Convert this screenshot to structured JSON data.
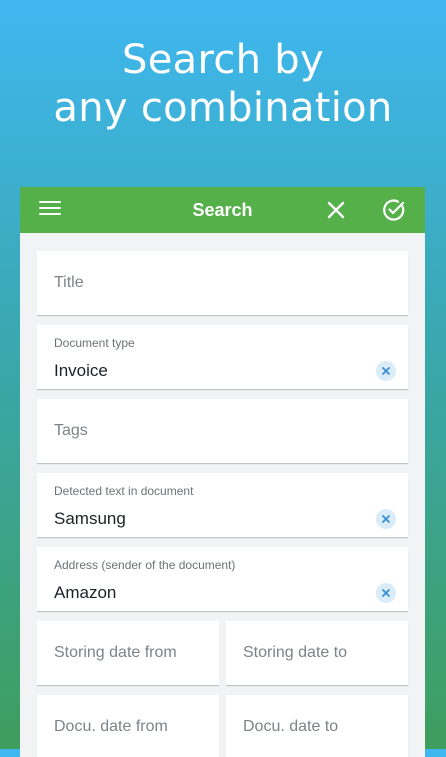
{
  "headline": {
    "line1": "Search by",
    "line2": "any combination"
  },
  "appbar": {
    "title": "Search"
  },
  "colors": {
    "appbar": "#55b04a",
    "clear_badge": "#d9ecf8",
    "clear_x": "#3a8fd6"
  },
  "icons": {
    "menu": "hamburger-icon",
    "close": "close-icon",
    "confirm": "check-circle-icon",
    "clear": "clear-x-icon"
  },
  "form": {
    "title": {
      "placeholder": "Title"
    },
    "document_type": {
      "label": "Document type",
      "value": "Invoice"
    },
    "tags": {
      "placeholder": "Tags"
    },
    "detected_text": {
      "label": "Detected text in document",
      "value": "Samsung"
    },
    "address": {
      "label": "Address (sender of the document)",
      "value": "Amazon"
    },
    "storing_date_from": {
      "placeholder": "Storing date from"
    },
    "storing_date_to": {
      "placeholder": "Storing date to"
    },
    "docu_date_from": {
      "placeholder": "Docu. date from"
    },
    "docu_date_to": {
      "placeholder": "Docu. date to"
    }
  }
}
